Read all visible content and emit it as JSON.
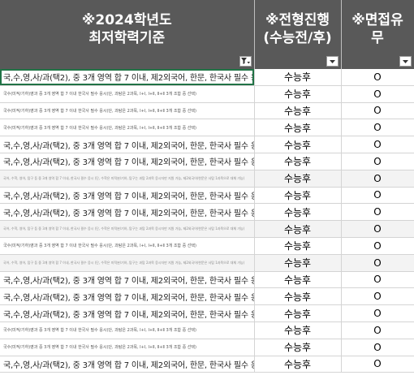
{
  "headers": {
    "col1_line1": "※2024학년도",
    "col1_line2": "최저학력기준",
    "col2_line1": "※전형진행",
    "col2_line2": "(수능전/후)",
    "col3_line1": "※면접유",
    "col3_line2": "무"
  },
  "filters": {
    "col1": "filter-active-icon",
    "col2": "dropdown-arrow-icon",
    "col3": "dropdown-arrow-icon"
  },
  "rows": [
    {
      "criterion": "국,수,영,사/과(택2), 중 3개 영역 합 7 이내, 제2외국어, 한문, 한국사 필수 응시",
      "progress": "수능후",
      "interview": "O"
    },
    {
      "criterion": "국수(미적/기하)영과 중 3개 영역 합 7 이내 한국사 필수 응시(단, 과탐은 2과목, Ⅰ+Ⅰ, Ⅰ+Ⅱ, Ⅱ+Ⅱ 3개 조합 중 선택)",
      "progress": "수능후",
      "interview": "O"
    },
    {
      "criterion": "국수(미적/기하)영과 중 3개 영역 합 7 이내 한국사 필수 응시(단, 과탐은 2과목, Ⅰ+Ⅰ, Ⅰ+Ⅱ, Ⅱ+Ⅱ 3개 조합 중 선택)",
      "progress": "수능후",
      "interview": "O"
    },
    {
      "criterion": "국수(미적/기하)영과 중 3개 영역 합 7 이내 한국사 필수 응시(단, 과탐은 2과목, Ⅰ+Ⅰ, Ⅰ+Ⅱ, Ⅱ+Ⅱ 3개 조합 중 선택)",
      "progress": "수능후",
      "interview": "O"
    },
    {
      "criterion": "국,수,영,사/과(택2), 중 3개 영역 합 7 이내, 제2외국어, 한문, 한국사 필수 응시",
      "progress": "수능후",
      "interview": "O"
    },
    {
      "criterion": "국,수,영,사/과(택2), 중 3개 영역 합 7 이내, 제2외국어, 한문, 한국사 필수 응시",
      "progress": "수능후",
      "interview": "O"
    },
    {
      "criterion": "국어, 수학, 영어, 탐구 등 중 3개 영역 합 7 이내, 한국사 필수 응시 (단, 수학은 미적분/기하, 탐구는 과탐 2과목 응시자만 지원 가능, 제2외국어/한문은 사탐 1과목으로 대체 가능)",
      "progress": "수능후",
      "interview": "O"
    },
    {
      "criterion": "국,수,영,사/과(택2), 중 3개 영역 합 7 이내, 제2외국어, 한문, 한국사 필수 응시",
      "progress": "수능후",
      "interview": "O"
    },
    {
      "criterion": "국,수,영,사/과(택2), 중 3개 영역 합 7 이내, 제2외국어, 한문, 한국사 필수 응시",
      "progress": "수능후",
      "interview": "O"
    },
    {
      "criterion": "국어, 수학, 영어, 탐구 등 중 3개 영역 합 7 이내, 한국사 필수 응시 (단, 수학은 미적분/기하, 탐구는 과탐 2과목 응시자만 지원 가능, 제2외국어/한문은 사탐 1과목으로 대체 가능)",
      "progress": "수능후",
      "interview": "O"
    },
    {
      "criterion": "국수(미적/기하)영과 중 3개 영역 합 7 이내 한국사 필수 응시(단, 과탐은 2과목, Ⅰ+Ⅰ, Ⅰ+Ⅱ, Ⅱ+Ⅱ 3개 조합 중 선택)",
      "progress": "수능후",
      "interview": "O"
    },
    {
      "criterion": "국어, 수학, 영어, 탐구 등 중 3개 영역 합 7 이내, 한국사 필수 응시 (단, 수학은 미적분/기하, 탐구는 과탐 2과목 응시자만 지원 가능, 제2외국어/한문은 사탐 1과목으로 대체 가능)",
      "progress": "수능후",
      "interview": "O"
    },
    {
      "criterion": "국,수,영,사/과(택2), 중 3개 영역 합 7 이내, 제2외국어, 한문, 한국사 필수 응시",
      "progress": "수능후",
      "interview": "O"
    },
    {
      "criterion": "국,수,영,사/과(택2), 중 3개 영역 합 7 이내, 제2외국어, 한문, 한국사 필수 응시",
      "progress": "수능후",
      "interview": "O"
    },
    {
      "criterion": "국,수,영,사/과(택2), 중 3개 영역 합 7 이내, 제2외국어, 한문, 한국사 필수 응시",
      "progress": "수능후",
      "interview": "O"
    },
    {
      "criterion": "국수(미적/기하)영과 중 3개 영역 합 7 이내 한국사 필수 응시(단, 과탐은 2과목, Ⅰ+Ⅰ, Ⅰ+Ⅱ, Ⅱ+Ⅱ 3개 조합 중 선택)",
      "progress": "수능후",
      "interview": "O"
    },
    {
      "criterion": "국수(미적/기하)영과 중 3개 영역 합 7 이내 한국사 필수 응시(단, 과탐은 2과목, Ⅰ+Ⅰ, Ⅰ+Ⅱ, Ⅱ+Ⅱ 3개 조합 중 선택)",
      "progress": "수능후",
      "interview": "O"
    },
    {
      "criterion": "국,수,영,사/과(택2), 중 3개 영역 합 7 이내, 제2외국어, 한문, 한국사 필수 응시",
      "progress": "수능후",
      "interview": "O"
    }
  ]
}
